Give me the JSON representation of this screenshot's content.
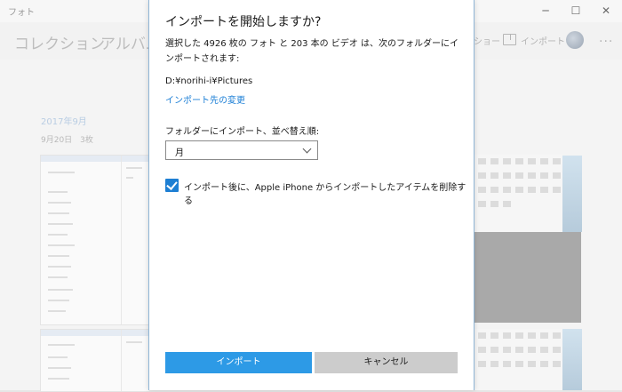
{
  "app": {
    "title": "フォト",
    "window_controls": {
      "minimize": "─",
      "maximize": "☐",
      "close": "✕"
    }
  },
  "nav": {
    "tabs": [
      "コレクション",
      "アルバム"
    ],
    "toolbar_partial": "ショー",
    "import_label": "インポート",
    "more": "···"
  },
  "content": {
    "date_header": "2017年9月",
    "date_sub": "9月20日　3枚"
  },
  "dialog": {
    "title": "インポートを開始しますか?",
    "description": "選択した 4926 枚の フォト と 203 本の ビデオ は、次のフォルダーにインポートされます:",
    "path": "D:¥norihi-i¥Pictures",
    "change_link": "インポート先の変更",
    "sort_label": "フォルダーにインポート、並べ替え順:",
    "sort_value": "月",
    "delete_checkbox_label": "インポート後に、Apple iPhone からインポートしたアイテムを削除する",
    "delete_checkbox_checked": true,
    "import_button": "インポート",
    "cancel_button": "キャンセル"
  },
  "colors": {
    "accent": "#2d9ae6",
    "link": "#1c7fd6",
    "checkbox": "#1e7fd3"
  }
}
